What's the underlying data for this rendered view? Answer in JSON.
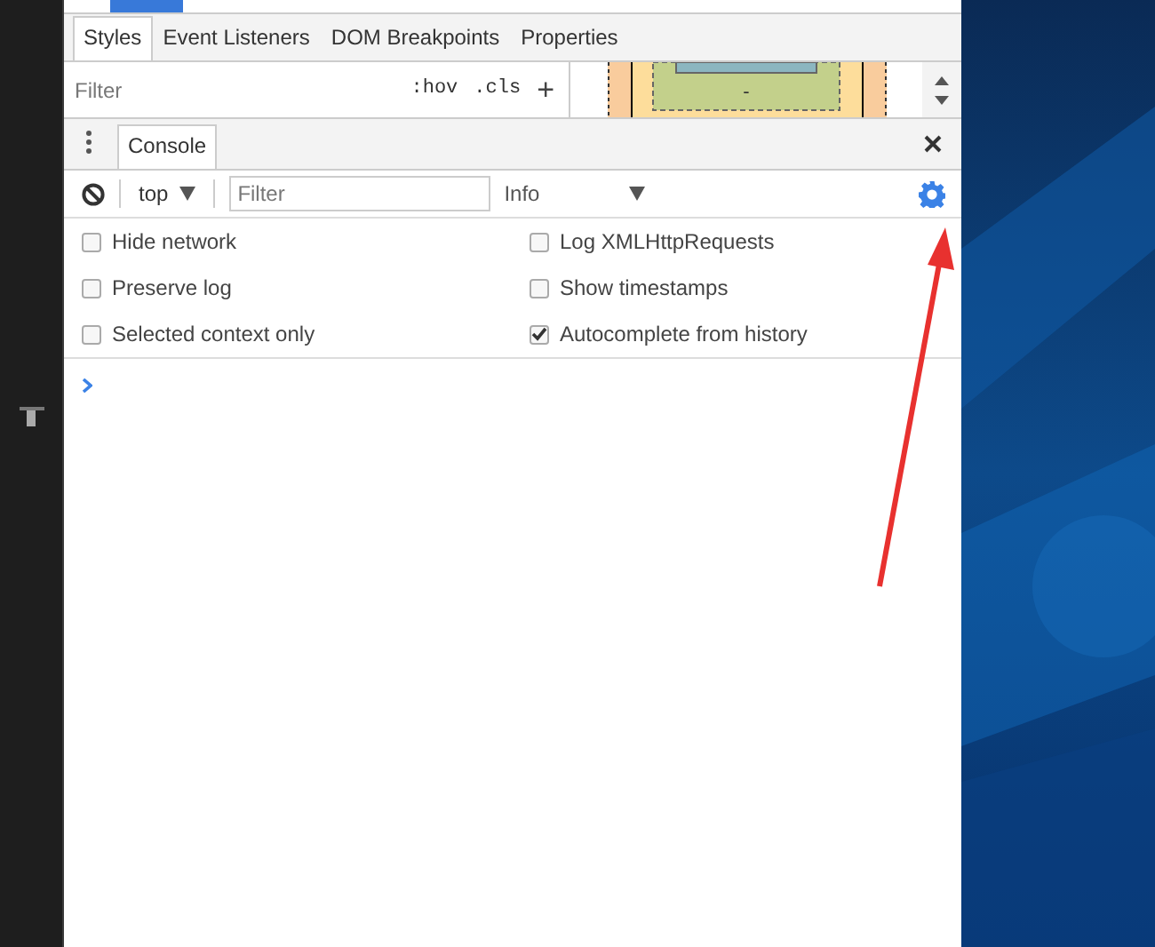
{
  "styles_tabs": [
    {
      "label": "Styles",
      "selected": true
    },
    {
      "label": "Event Listeners",
      "selected": false
    },
    {
      "label": "DOM Breakpoints",
      "selected": false
    },
    {
      "label": "Properties",
      "selected": false
    }
  ],
  "styles_filter": {
    "placeholder": "Filter",
    "hov": ":hov",
    "cls": ".cls",
    "add": "+"
  },
  "box_model": {
    "content": "-"
  },
  "drawer_tabs": [
    {
      "label": "Console",
      "selected": true
    }
  ],
  "console_toolbar": {
    "context": "top",
    "filter_placeholder": "Filter",
    "level": "Info"
  },
  "settings": [
    {
      "label": "Hide network",
      "checked": false
    },
    {
      "label": "Log XMLHttpRequests",
      "checked": false
    },
    {
      "label": "Preserve log",
      "checked": false
    },
    {
      "label": "Show timestamps",
      "checked": false
    },
    {
      "label": "Selected context only",
      "checked": false
    },
    {
      "label": "Autocomplete from history",
      "checked": true
    }
  ]
}
